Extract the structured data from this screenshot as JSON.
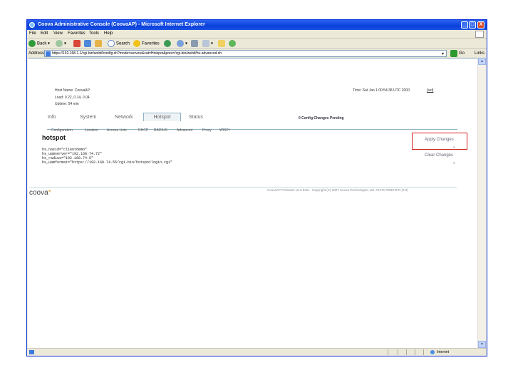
{
  "window": {
    "title": "Coova Administrative Console (CoovaAP) - Microsoft Internet Explorer",
    "controls": [
      "_",
      "□",
      "X"
    ]
  },
  "menu": [
    "File",
    "Edit",
    "View",
    "Favorites",
    "Tools",
    "Help"
  ],
  "toolbar": {
    "back": "Back",
    "search": "Search",
    "favorites": "Favorites"
  },
  "address": {
    "label": "Address",
    "url": "https://192.168.1.1/cgi-bin/webif/config.sh?mode=service&cat=Hotspot&prev=/cgi-bin/webif/hs-advanced.sh",
    "go": "Go",
    "links": "Links"
  },
  "statusbar": {
    "zone": "Internet"
  },
  "page": {
    "host_name": "Host Name: CoovaAP",
    "load": "Load: 0.22, 0.14, 0.04",
    "uptime": "Uptime: 54 min",
    "time": "Time: Sat Jan 1 00:54:38 UTC 2000",
    "time_link": "[set]",
    "tabs": [
      "Info",
      "System",
      "Network",
      "Hotspot",
      "Status"
    ],
    "pending": "0 Config Changes Pending",
    "subtabs": [
      "Configuration",
      "Location",
      "Access Lists",
      "DHCP",
      "RADIUS",
      "Advanced",
      "Proxy",
      "WISPr"
    ],
    "heading": "hotspot",
    "config_lines": [
      "hs_nasid=\"clientdemo\"",
      "hs_uamserver=\"192.168.74.72\"",
      "hs_radius=\"192.168.74.5\"",
      "hs_uamformat=\"https://192.168.74.55/cgi-bin/hotspotlogin.cgi\""
    ],
    "apply_changes": "Apply Changes",
    "apply_arrow": "«",
    "clear_changes": "Clear Changes",
    "clear_arrow": "«",
    "logo": "coova",
    "copyright": "CoovaAP Firmware v0.0 beta - Copyright (C) 2007 Coova Technologies Ltd. #4175 #08574FR (0.9)"
  }
}
